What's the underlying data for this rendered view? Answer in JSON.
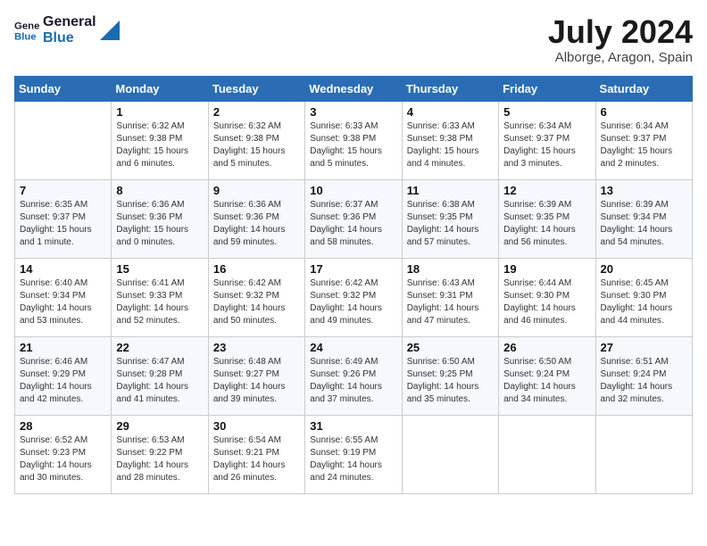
{
  "header": {
    "logo_line1": "General",
    "logo_line2": "Blue",
    "month": "July 2024",
    "location": "Alborge, Aragon, Spain"
  },
  "weekdays": [
    "Sunday",
    "Monday",
    "Tuesday",
    "Wednesday",
    "Thursday",
    "Friday",
    "Saturday"
  ],
  "weeks": [
    [
      {
        "day": "",
        "empty": true
      },
      {
        "day": "1",
        "sunrise": "6:32 AM",
        "sunset": "9:38 PM",
        "daylight": "15 hours and 6 minutes."
      },
      {
        "day": "2",
        "sunrise": "6:32 AM",
        "sunset": "9:38 PM",
        "daylight": "15 hours and 5 minutes."
      },
      {
        "day": "3",
        "sunrise": "6:33 AM",
        "sunset": "9:38 PM",
        "daylight": "15 hours and 5 minutes."
      },
      {
        "day": "4",
        "sunrise": "6:33 AM",
        "sunset": "9:38 PM",
        "daylight": "15 hours and 4 minutes."
      },
      {
        "day": "5",
        "sunrise": "6:34 AM",
        "sunset": "9:37 PM",
        "daylight": "15 hours and 3 minutes."
      },
      {
        "day": "6",
        "sunrise": "6:34 AM",
        "sunset": "9:37 PM",
        "daylight": "15 hours and 2 minutes."
      }
    ],
    [
      {
        "day": "7",
        "sunrise": "6:35 AM",
        "sunset": "9:37 PM",
        "daylight": "15 hours and 1 minute."
      },
      {
        "day": "8",
        "sunrise": "6:36 AM",
        "sunset": "9:36 PM",
        "daylight": "15 hours and 0 minutes."
      },
      {
        "day": "9",
        "sunrise": "6:36 AM",
        "sunset": "9:36 PM",
        "daylight": "14 hours and 59 minutes."
      },
      {
        "day": "10",
        "sunrise": "6:37 AM",
        "sunset": "9:36 PM",
        "daylight": "14 hours and 58 minutes."
      },
      {
        "day": "11",
        "sunrise": "6:38 AM",
        "sunset": "9:35 PM",
        "daylight": "14 hours and 57 minutes."
      },
      {
        "day": "12",
        "sunrise": "6:39 AM",
        "sunset": "9:35 PM",
        "daylight": "14 hours and 56 minutes."
      },
      {
        "day": "13",
        "sunrise": "6:39 AM",
        "sunset": "9:34 PM",
        "daylight": "14 hours and 54 minutes."
      }
    ],
    [
      {
        "day": "14",
        "sunrise": "6:40 AM",
        "sunset": "9:34 PM",
        "daylight": "14 hours and 53 minutes."
      },
      {
        "day": "15",
        "sunrise": "6:41 AM",
        "sunset": "9:33 PM",
        "daylight": "14 hours and 52 minutes."
      },
      {
        "day": "16",
        "sunrise": "6:42 AM",
        "sunset": "9:32 PM",
        "daylight": "14 hours and 50 minutes."
      },
      {
        "day": "17",
        "sunrise": "6:42 AM",
        "sunset": "9:32 PM",
        "daylight": "14 hours and 49 minutes."
      },
      {
        "day": "18",
        "sunrise": "6:43 AM",
        "sunset": "9:31 PM",
        "daylight": "14 hours and 47 minutes."
      },
      {
        "day": "19",
        "sunrise": "6:44 AM",
        "sunset": "9:30 PM",
        "daylight": "14 hours and 46 minutes."
      },
      {
        "day": "20",
        "sunrise": "6:45 AM",
        "sunset": "9:30 PM",
        "daylight": "14 hours and 44 minutes."
      }
    ],
    [
      {
        "day": "21",
        "sunrise": "6:46 AM",
        "sunset": "9:29 PM",
        "daylight": "14 hours and 42 minutes."
      },
      {
        "day": "22",
        "sunrise": "6:47 AM",
        "sunset": "9:28 PM",
        "daylight": "14 hours and 41 minutes."
      },
      {
        "day": "23",
        "sunrise": "6:48 AM",
        "sunset": "9:27 PM",
        "daylight": "14 hours and 39 minutes."
      },
      {
        "day": "24",
        "sunrise": "6:49 AM",
        "sunset": "9:26 PM",
        "daylight": "14 hours and 37 minutes."
      },
      {
        "day": "25",
        "sunrise": "6:50 AM",
        "sunset": "9:25 PM",
        "daylight": "14 hours and 35 minutes."
      },
      {
        "day": "26",
        "sunrise": "6:50 AM",
        "sunset": "9:24 PM",
        "daylight": "14 hours and 34 minutes."
      },
      {
        "day": "27",
        "sunrise": "6:51 AM",
        "sunset": "9:24 PM",
        "daylight": "14 hours and 32 minutes."
      }
    ],
    [
      {
        "day": "28",
        "sunrise": "6:52 AM",
        "sunset": "9:23 PM",
        "daylight": "14 hours and 30 minutes."
      },
      {
        "day": "29",
        "sunrise": "6:53 AM",
        "sunset": "9:22 PM",
        "daylight": "14 hours and 28 minutes."
      },
      {
        "day": "30",
        "sunrise": "6:54 AM",
        "sunset": "9:21 PM",
        "daylight": "14 hours and 26 minutes."
      },
      {
        "day": "31",
        "sunrise": "6:55 AM",
        "sunset": "9:19 PM",
        "daylight": "14 hours and 24 minutes."
      },
      {
        "day": "",
        "empty": true
      },
      {
        "day": "",
        "empty": true
      },
      {
        "day": "",
        "empty": true
      }
    ]
  ],
  "labels": {
    "sunrise_prefix": "Sunrise: ",
    "sunset_prefix": "Sunset: ",
    "daylight_prefix": "Daylight: "
  }
}
